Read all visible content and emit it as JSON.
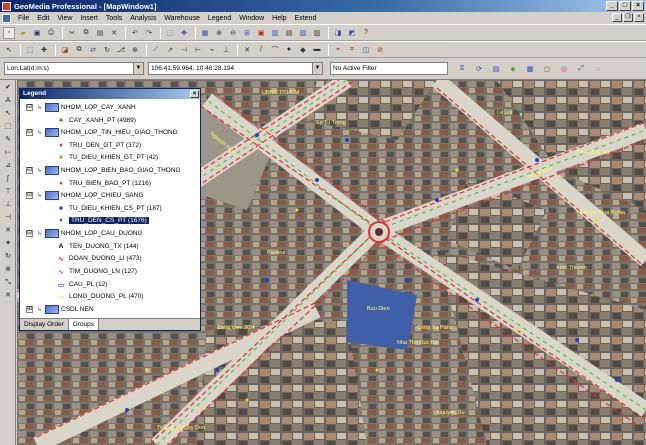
{
  "titlebar": {
    "title": "GeoMedia Professional - [MapWindow1]"
  },
  "menu": [
    "File",
    "Edit",
    "View",
    "Insert",
    "Tools",
    "Analysis",
    "Warehouse",
    "Legend",
    "Window",
    "Help",
    "Extend"
  ],
  "addressbar": {
    "coord_system": "Lon,Lat(d:m:s)",
    "coordinates": "106:41:59.964, 10:46:28.194",
    "filter": "No Active Filter"
  },
  "legend": {
    "title": "Legend",
    "entries": [
      {
        "label": "NHOM_LOP_CAY_XANH",
        "kind": "group",
        "sign": "⊟"
      },
      {
        "label": "CAY_XANH_PT (4989)",
        "kind": "layer",
        "icon": "tree-icon",
        "color": "#2a9a2a"
      },
      {
        "label": "NHOM_LOP_TIN_HIEU_GIAO_THONG",
        "kind": "group",
        "sign": "⊟"
      },
      {
        "label": "TRU_DEN_GT_PT (372)",
        "kind": "layer",
        "icon": "pin-icon",
        "color": "#d02020"
      },
      {
        "label": "TU_DIEU_KHIEN_GT_PT (42)",
        "kind": "layer",
        "icon": "box-icon",
        "color": "#d0a020"
      },
      {
        "label": "NHOM_LOP_BIEN_BAO_GIAO_THONG",
        "kind": "group",
        "sign": "⊟"
      },
      {
        "label": "TRU_BIEN_BAO_PT (1216)",
        "kind": "layer",
        "icon": "pin-icon",
        "color": "#c83030"
      },
      {
        "label": "NHOM_LOP_CHIEU_SANG",
        "kind": "group",
        "sign": "⊟"
      },
      {
        "label": "TU_DIEU_KHIEN_CS_PT (187)",
        "kind": "layer",
        "icon": "box-icon",
        "color": "#2040c0"
      },
      {
        "label": "TRU_DEN_CS_PT (1676)",
        "kind": "layer",
        "icon": "pin-icon",
        "color": "#2050d0",
        "selected": true
      },
      {
        "label": "NHOM_LOP_CAU_DUONG",
        "kind": "group",
        "sign": "⊟"
      },
      {
        "label": "TEN_DUONG_TX (144)",
        "kind": "layer",
        "icon": "text-icon",
        "color": "#000000"
      },
      {
        "label": "DOAN_DUONG_LI (473)",
        "kind": "layer",
        "icon": "line-icon",
        "color": "#e02020"
      },
      {
        "label": "TIM_DUONG_LN (127)",
        "kind": "layer",
        "icon": "line-icon",
        "color": "#e040a0"
      },
      {
        "label": "CAU_PL (12)",
        "kind": "layer",
        "icon": "area-icon",
        "color": "#4060d0"
      },
      {
        "label": "LONG_DUONG_PL (470)",
        "kind": "layer",
        "icon": "area-icon",
        "color": "#f0e080"
      },
      {
        "label": "CSDL NEN",
        "kind": "group",
        "sign": "⊞"
      }
    ],
    "tabs": [
      "Display Order",
      "Groups"
    ]
  },
  "map_labels": [
    {
      "text": "UBND TP.HCM"
    },
    {
      "text": "Nguyen Hue"
    },
    {
      "text": "Le Loi"
    },
    {
      "text": "Dong Khoi"
    },
    {
      "text": "Le Thanh Ton"
    },
    {
      "text": "Pasteur"
    },
    {
      "text": "Nha Tho Duc Ba"
    },
    {
      "text": "Buu Dien"
    },
    {
      "text": "Cong Xa Paris"
    },
    {
      "text": "Nguyen Du"
    },
    {
      "text": "Han Thuyen"
    },
    {
      "text": "Cong Vien 30/4"
    },
    {
      "text": "Truong Le Quy Don"
    },
    {
      "text": "Ly Tu Trong"
    },
    {
      "text": "Nam Ky Khoi Nghia"
    }
  ]
}
